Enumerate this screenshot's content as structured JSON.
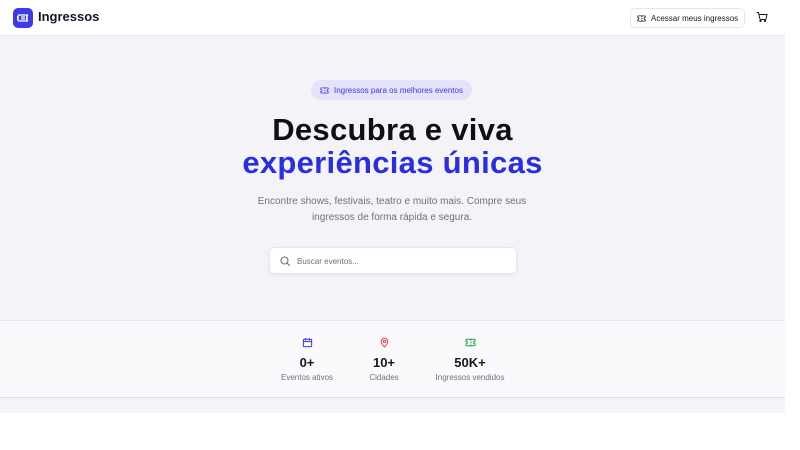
{
  "navbar": {
    "brand": "Ingressos",
    "logo_icon": "ticket-icon",
    "tickets_button_label": "Acessar meus ingressos",
    "cart_icon": "cart-icon"
  },
  "hero": {
    "pill_label": "Ingressos para os melhores eventos",
    "title_line1": "Descubra e viva",
    "title_line2": "experiências únicas",
    "subtitle": "Encontre shows, festivais, teatro e muito mais. Compre seus ingressos de forma rápida e segura.",
    "search_placeholder": "Buscar eventos...",
    "search_value": ""
  },
  "stats": [
    {
      "value": "0+",
      "label": "Eventos ativos",
      "icon": "calendar-icon",
      "color": "#3b3be8"
    },
    {
      "value": "10+",
      "label": "Cidades",
      "icon": "map-pin-icon",
      "color": "#ef4444"
    },
    {
      "value": "50K+",
      "label": "Ingressos vendidos",
      "icon": "ticket-icon",
      "color": "#16a34a"
    }
  ],
  "colors": {
    "accent": "#2b2ee0",
    "hero_bg": "#f4f3f8",
    "pill_bg": "#e4e3fb"
  }
}
